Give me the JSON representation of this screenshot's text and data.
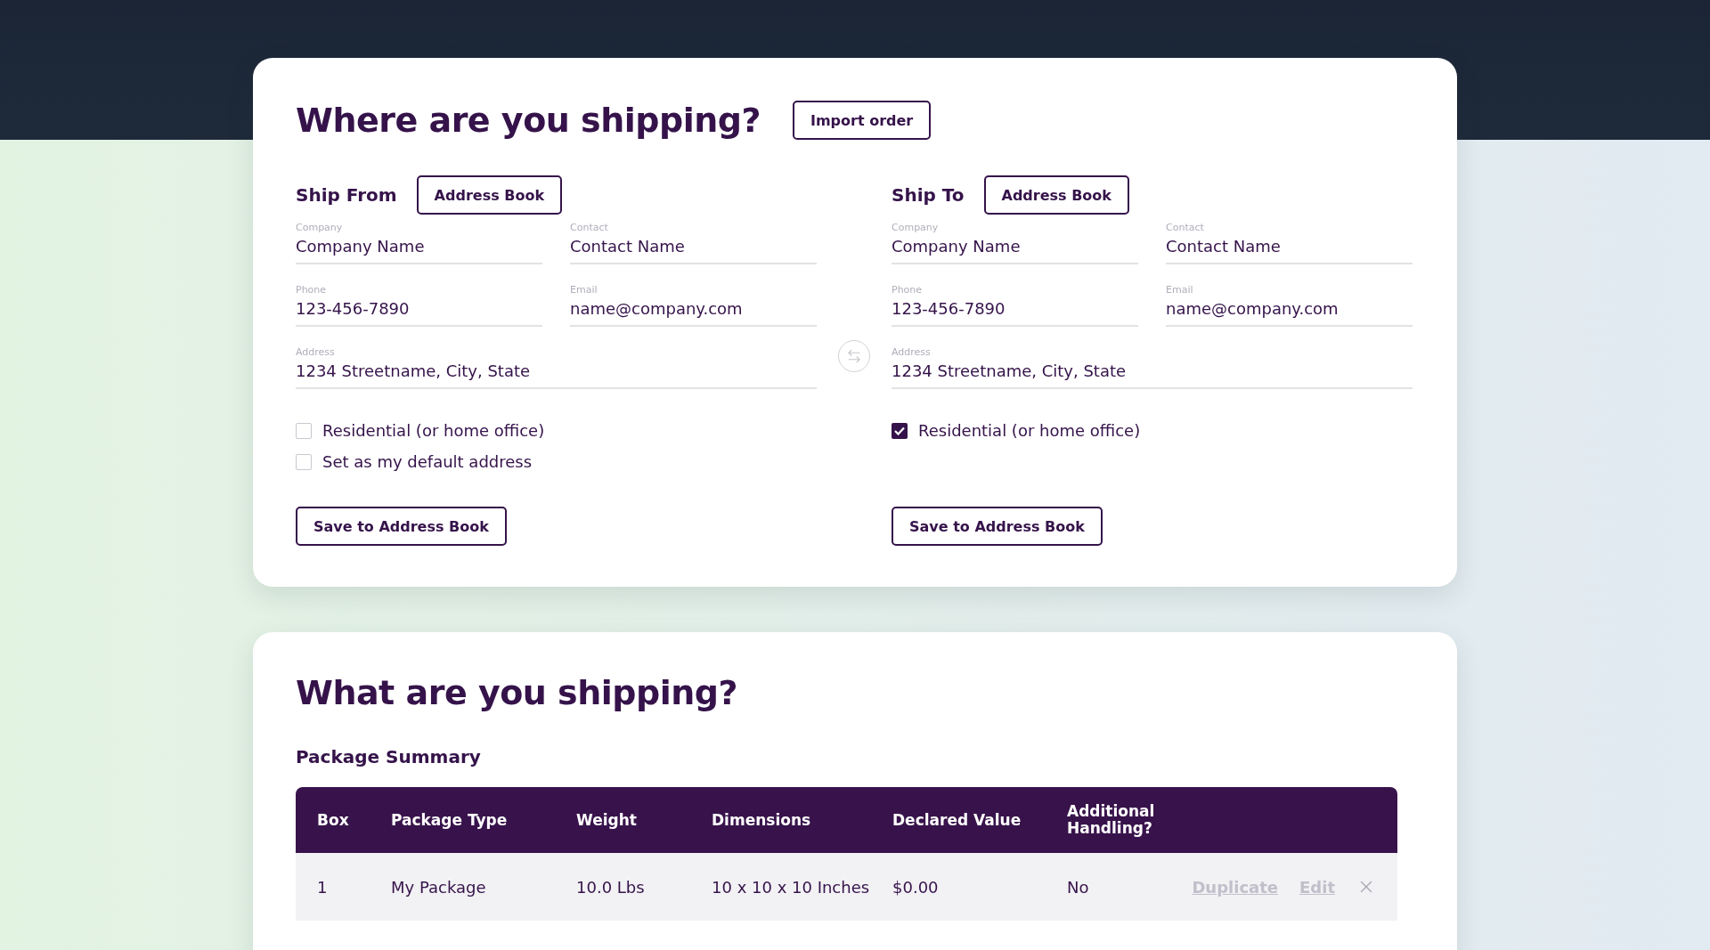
{
  "heading": "Where are you shipping?",
  "import_button": "Import order",
  "addresses": [
    {
      "title": "Ship From",
      "address_book_button": "Address Book",
      "fields": [
        {
          "label": "Company",
          "value": "Company Name"
        },
        {
          "label": "Contact",
          "value": "Contact Name"
        },
        {
          "label": "Phone",
          "value": "123-456-7890"
        },
        {
          "label": "Email",
          "value": "name@company.com"
        }
      ],
      "address": {
        "label": "Address",
        "value": "1234 Streetname, City, State"
      },
      "checkboxes": [
        {
          "label": "Residential (or home office)",
          "checked": false
        },
        {
          "label": "Set as my default address",
          "checked": false
        }
      ],
      "save_button": "Save to Address Book"
    },
    {
      "title": "Ship To",
      "address_book_button": "Address Book",
      "fields": [
        {
          "label": "Company",
          "value": "Company Name"
        },
        {
          "label": "Contact",
          "value": "Contact Name"
        },
        {
          "label": "Phone",
          "value": "123-456-7890"
        },
        {
          "label": "Email",
          "value": "name@company.com"
        }
      ],
      "address": {
        "label": "Address",
        "value": "1234 Streetname, City, State"
      },
      "checkboxes": [
        {
          "label": "Residential (or home office)",
          "checked": true
        }
      ],
      "save_button": "Save to Address Book"
    }
  ],
  "shipping": {
    "heading": "What are you shipping?",
    "summary_title": "Package Summary",
    "table": {
      "columns": [
        "Box",
        "Package Type",
        "Weight",
        "Dimensions",
        "Declared Value",
        "Additional Handling?"
      ],
      "rows": [
        {
          "cells": [
            "1",
            "My Package",
            "10.0 Lbs",
            "10 x 10 x 10 Inches",
            "$0.00",
            "No"
          ],
          "actions": [
            "Duplicate",
            "Edit"
          ]
        }
      ]
    }
  }
}
